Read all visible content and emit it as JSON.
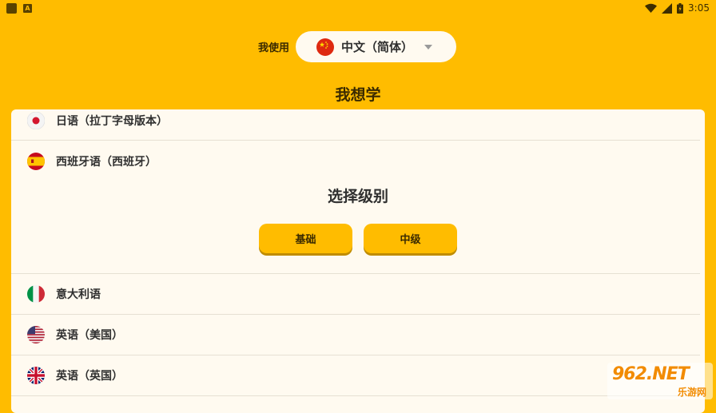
{
  "statusbar": {
    "time": "3:05"
  },
  "header": {
    "use_label": "我使用",
    "selected_language": "中文（简体）",
    "want_title": "我想学"
  },
  "languages": [
    {
      "label": "日语（拉丁字母版本）",
      "flag": "japan-flag-icon"
    },
    {
      "label": "西班牙语（西班牙）",
      "flag": "spain-flag-icon"
    },
    {
      "label": "意大利语",
      "flag": "italy-flag-icon"
    },
    {
      "label": "英语（美国）",
      "flag": "usa-flag-icon"
    },
    {
      "label": "英语（英国）",
      "flag": "uk-flag-icon"
    }
  ],
  "level_picker": {
    "title": "选择级别",
    "basic_label": "基础",
    "intermediate_label": "中级"
  },
  "watermark": {
    "main": "962.NET",
    "sub": "乐游网"
  },
  "colors": {
    "accent": "#FFBC00",
    "panel": "#FFFAF0",
    "button_shadow": "#C08C00"
  }
}
